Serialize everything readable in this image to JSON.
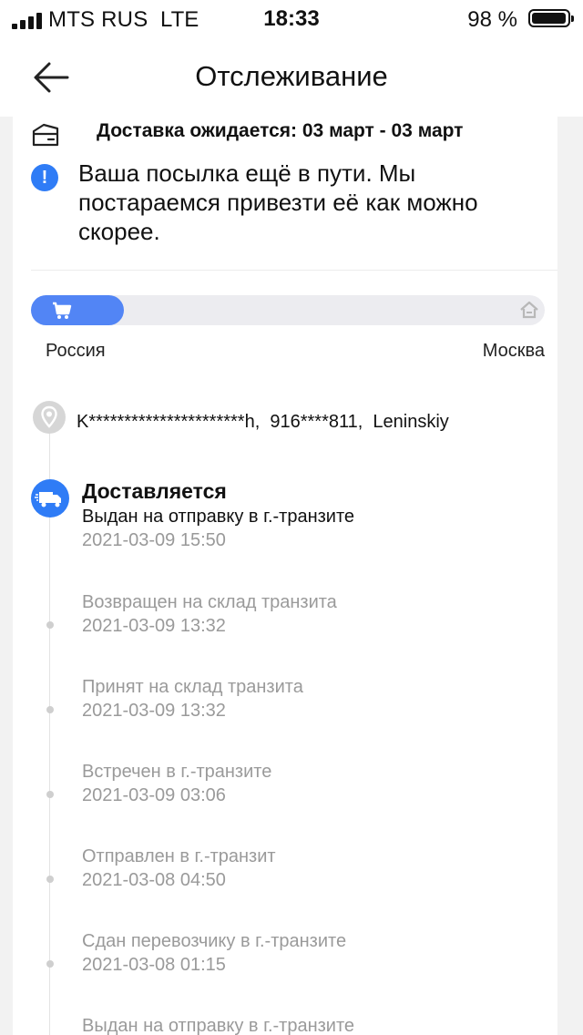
{
  "status_bar": {
    "carrier": "MTS RUS",
    "network": "LTE",
    "time": "18:33",
    "battery_text": "98 %",
    "battery_level": 0.98
  },
  "header": {
    "title": "Отслеживание",
    "back_icon": "arrow-left-icon"
  },
  "delivery": {
    "expected_text": "Доставка ожидается: 03 март - 03 март",
    "icon": "delivery-box-icon"
  },
  "notice": {
    "icon": "info-icon",
    "text": "Ваша посылка ещё в пути. Мы постараемся привезти её как можно скорее."
  },
  "progress": {
    "fraction": 0.18,
    "origin": "Россия",
    "destination": "Москва",
    "accent_color": "#5285f5",
    "start_icon": "cart-icon",
    "end_icon": "home-icon"
  },
  "address": {
    "icon": "location-pin-icon",
    "text": "K**********************h,  916****811,  Leninskiy"
  },
  "current": {
    "icon": "truck-icon",
    "status": "Доставляется",
    "description": "Выдан на отправку в г.-транзите",
    "time": "2021-03-09 15:50"
  },
  "events": [
    {
      "description": "Возвращен на склад транзита",
      "time": "2021-03-09 13:32"
    },
    {
      "description": "Принят на склад транзита",
      "time": "2021-03-09 13:32"
    },
    {
      "description": "Встречен в г.-транзите",
      "time": "2021-03-09 03:06"
    },
    {
      "description": "Отправлен в г.-транзит",
      "time": "2021-03-08 04:50"
    },
    {
      "description": "Сдан перевозчику в г.-транзите",
      "time": "2021-03-08 01:15"
    },
    {
      "description": "Выдан на отправку в г.-транзите",
      "time": ""
    }
  ]
}
